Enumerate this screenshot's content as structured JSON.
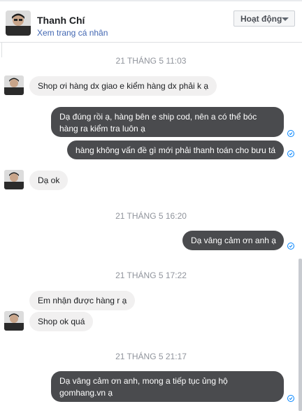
{
  "header": {
    "name": "Thanh Chí",
    "profile_link": "Xem trang cá nhân",
    "status_button": "Hoạt động"
  },
  "timestamps": [
    "21 THÁNG 5 11:03",
    "21 THÁNG 5 16:20",
    "21 THÁNG 5 17:22",
    "21 THÁNG 5 21:17"
  ],
  "messages": [
    {
      "sender": "them",
      "text": "Shop ơi hàng dx giao e kiểm hàng dx phải k ạ"
    },
    {
      "sender": "me",
      "text": "Dạ đúng rồi ạ, hàng bên e ship cod, nên a có thể bóc hàng ra kiểm tra luôn ạ"
    },
    {
      "sender": "me",
      "text": "hàng không vấn đề gì mới phải thanh toán cho bưu tá"
    },
    {
      "sender": "them",
      "text": "Dạ ok"
    },
    {
      "sender": "me",
      "text": "Dạ vâng cảm ơn anh ạ"
    },
    {
      "sender": "them",
      "text": "Em nhận được hàng r ạ"
    },
    {
      "sender": "them",
      "text": "Shop ok quá"
    },
    {
      "sender": "me",
      "text": "Dạ vâng cảm ơn anh, mong a tiếp tục ủng hộ gomhang.vn ạ"
    }
  ],
  "colors": {
    "outgoing_bubble": "#4a4b4e",
    "incoming_bubble": "#f1f0f0",
    "link": "#4267b2",
    "seen_check": "#0084ff"
  }
}
